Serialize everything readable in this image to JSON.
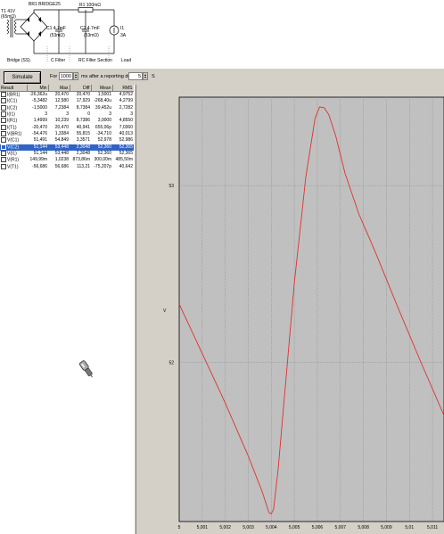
{
  "schematic": {
    "title": "BR1 BRIDGE25",
    "source": "T1 41V",
    "source_res": "(65mΩ)",
    "r1": "R1 100mΩ",
    "c1": "C1 4.7mF",
    "c1_esr": "(53mΩ)",
    "c2": "C2 4.7mF",
    "c2_esr": "(53mΩ)",
    "load_value": "3A",
    "load_id": "I1",
    "section_bridge": "Bridge (SS)",
    "section_cfilter": "C Filter",
    "section_rcfilter": "RC Filter Section",
    "section_load": "Load"
  },
  "controls": {
    "simulate_label": "Simulate",
    "for_label": "For",
    "duration_value": "1000",
    "duration_unit": "ms",
    "delay_label": "after a reporting delay of",
    "delay_value": "5",
    "delay_unit": "S"
  },
  "results": {
    "headers": [
      "Result",
      "Min",
      "Max",
      "Diff",
      "Mean",
      "RMS"
    ],
    "rows": [
      {
        "name": "I(BR1)",
        "min": "-26,362u",
        "max": "20,470",
        "diff": "20,470",
        "mean": "1,5001",
        "rms": "4,9752",
        "checked": false,
        "selected": false
      },
      {
        "name": "I(C1)",
        "min": "-5,3482",
        "max": "12,580",
        "diff": "17,929",
        "mean": "-268,40u",
        "rms": "4,2799",
        "checked": false,
        "selected": false
      },
      {
        "name": "I(C2)",
        "min": "-1,5000",
        "max": "7,2384",
        "diff": "8,7384",
        "mean": "39,452u",
        "rms": "2,7282",
        "checked": false,
        "selected": false
      },
      {
        "name": "I(I1)",
        "min": "3",
        "max": "3",
        "diff": "0",
        "mean": "3",
        "rms": "3",
        "checked": false,
        "selected": false
      },
      {
        "name": "I(R1)",
        "min": "1,4999",
        "max": "10,239",
        "diff": "8,7386",
        "mean": "3,0000",
        "rms": "4,8550",
        "checked": false,
        "selected": false
      },
      {
        "name": "I(T1)",
        "min": "-20,470",
        "max": "20,470",
        "diff": "40,941",
        "mean": "655,06p",
        "rms": "7,0360",
        "checked": false,
        "selected": false
      },
      {
        "name": "V(BR1)",
        "min": "-54,476",
        "max": "1,3384",
        "diff": "55,815",
        "mean": "-34,710",
        "rms": "40,013",
        "checked": false,
        "selected": false
      },
      {
        "name": "V(C1)",
        "min": "51,491",
        "max": "54,849",
        "diff": "3,3571",
        "mean": "52,978",
        "rms": "52,986",
        "checked": false,
        "selected": false
      },
      {
        "name": "V(C2)",
        "min": "51,144",
        "max": "53,448",
        "diff": "2,3048",
        "mean": "52,360",
        "rms": "52,365",
        "checked": true,
        "selected": true
      },
      {
        "name": "V(I1)",
        "min": "51,144",
        "max": "53,448",
        "diff": "2,3048",
        "mean": "52,360",
        "rms": "52,365",
        "checked": false,
        "selected": false
      },
      {
        "name": "V(R1)",
        "min": "149,99m",
        "max": "1,0238",
        "diff": "873,86m",
        "mean": "300,00m",
        "rms": "485,50m",
        "checked": false,
        "selected": false
      },
      {
        "name": "V(T1)",
        "min": "-56,686",
        "max": "56,686",
        "diff": "113,21",
        "mean": "-75,207p",
        "rms": "40,642",
        "checked": false,
        "selected": false
      }
    ]
  },
  "chart_data": {
    "type": "line",
    "ylabel": "V",
    "xlabel": "",
    "xticks": [
      "5",
      "5,001",
      "5,002",
      "5,003",
      "5,004",
      "5,005",
      "5,006",
      "5,007",
      "5,008",
      "5,009",
      "5,01",
      "5,011"
    ],
    "yticks": [
      "52",
      "53"
    ],
    "xlim": [
      5.0,
      5.0115
    ],
    "ylim": [
      51.1,
      53.5
    ],
    "grid": true,
    "series": [
      {
        "color": "#e03030",
        "x": [
          5.0,
          5.001,
          5.002,
          5.003,
          5.0036,
          5.0038,
          5.0039,
          5.004,
          5.0041,
          5.0043,
          5.0046,
          5.005,
          5.0055,
          5.0059,
          5.0061,
          5.0063,
          5.0065,
          5.0068,
          5.0072,
          5.0078,
          5.0085,
          5.0095,
          5.0105,
          5.0115
        ],
        "y": [
          52.33,
          52.05,
          51.77,
          51.47,
          51.27,
          51.19,
          51.15,
          51.144,
          51.17,
          51.4,
          51.85,
          52.45,
          53.05,
          53.38,
          53.445,
          53.44,
          53.4,
          53.28,
          53.07,
          52.84,
          52.63,
          52.31,
          52.0,
          51.7
        ]
      }
    ]
  }
}
